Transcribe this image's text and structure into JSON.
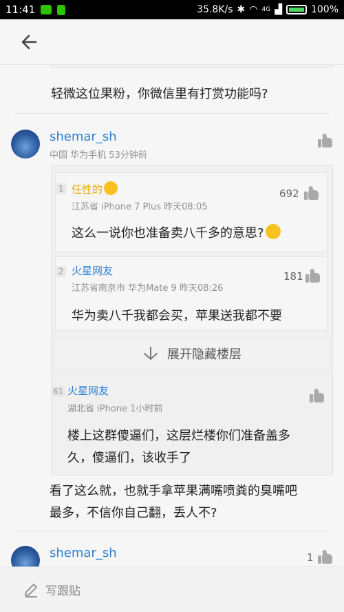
{
  "status_bar": {
    "time": "11:41",
    "net_speed": "35.8K/s",
    "signal_label": "4G",
    "battery": "100%"
  },
  "thread": {
    "prev_comment_tail": "轻微这位果粉，你微信里有打赏功能吗?",
    "comment1": {
      "username": "shemar_sh",
      "meta": "中国  华为手机  53分钟前",
      "quotes": [
        {
          "floor": "1",
          "name": "任性的",
          "meta": "江苏省  iPhone 7 Plus  昨天08:05",
          "likes": "692",
          "text": "这么一说你也准备卖八千多的意思?"
        },
        {
          "floor": "2",
          "name": "火星网友",
          "meta": "江苏省南京市  华为Mate 9  昨天08:26",
          "likes": "181",
          "text": "华为卖八千我都会买，苹果送我都不要"
        }
      ],
      "expand_label": "展开隐藏楼层",
      "last_quote": {
        "floor": "61",
        "name": "火星网友",
        "meta": "湖北省  iPhone  1小时前",
        "text_line1": "楼上这群傻逼们，这层烂楼你们准备盖多",
        "text_line2": "久，傻逼们，该收手了"
      },
      "body_line1": "看了这么就，也就手拿苹果满嘴喷粪的臭嘴吧",
      "body_line2": "最多，不信你自己翻，丢人不?"
    },
    "comment2": {
      "username": "shemar_sh",
      "likes": "1"
    }
  },
  "bottom_bar": {
    "reply_label": "写跟贴"
  },
  "colors": {
    "username_blue": "#2c7fd6",
    "vip_gold": "#e6a700"
  }
}
